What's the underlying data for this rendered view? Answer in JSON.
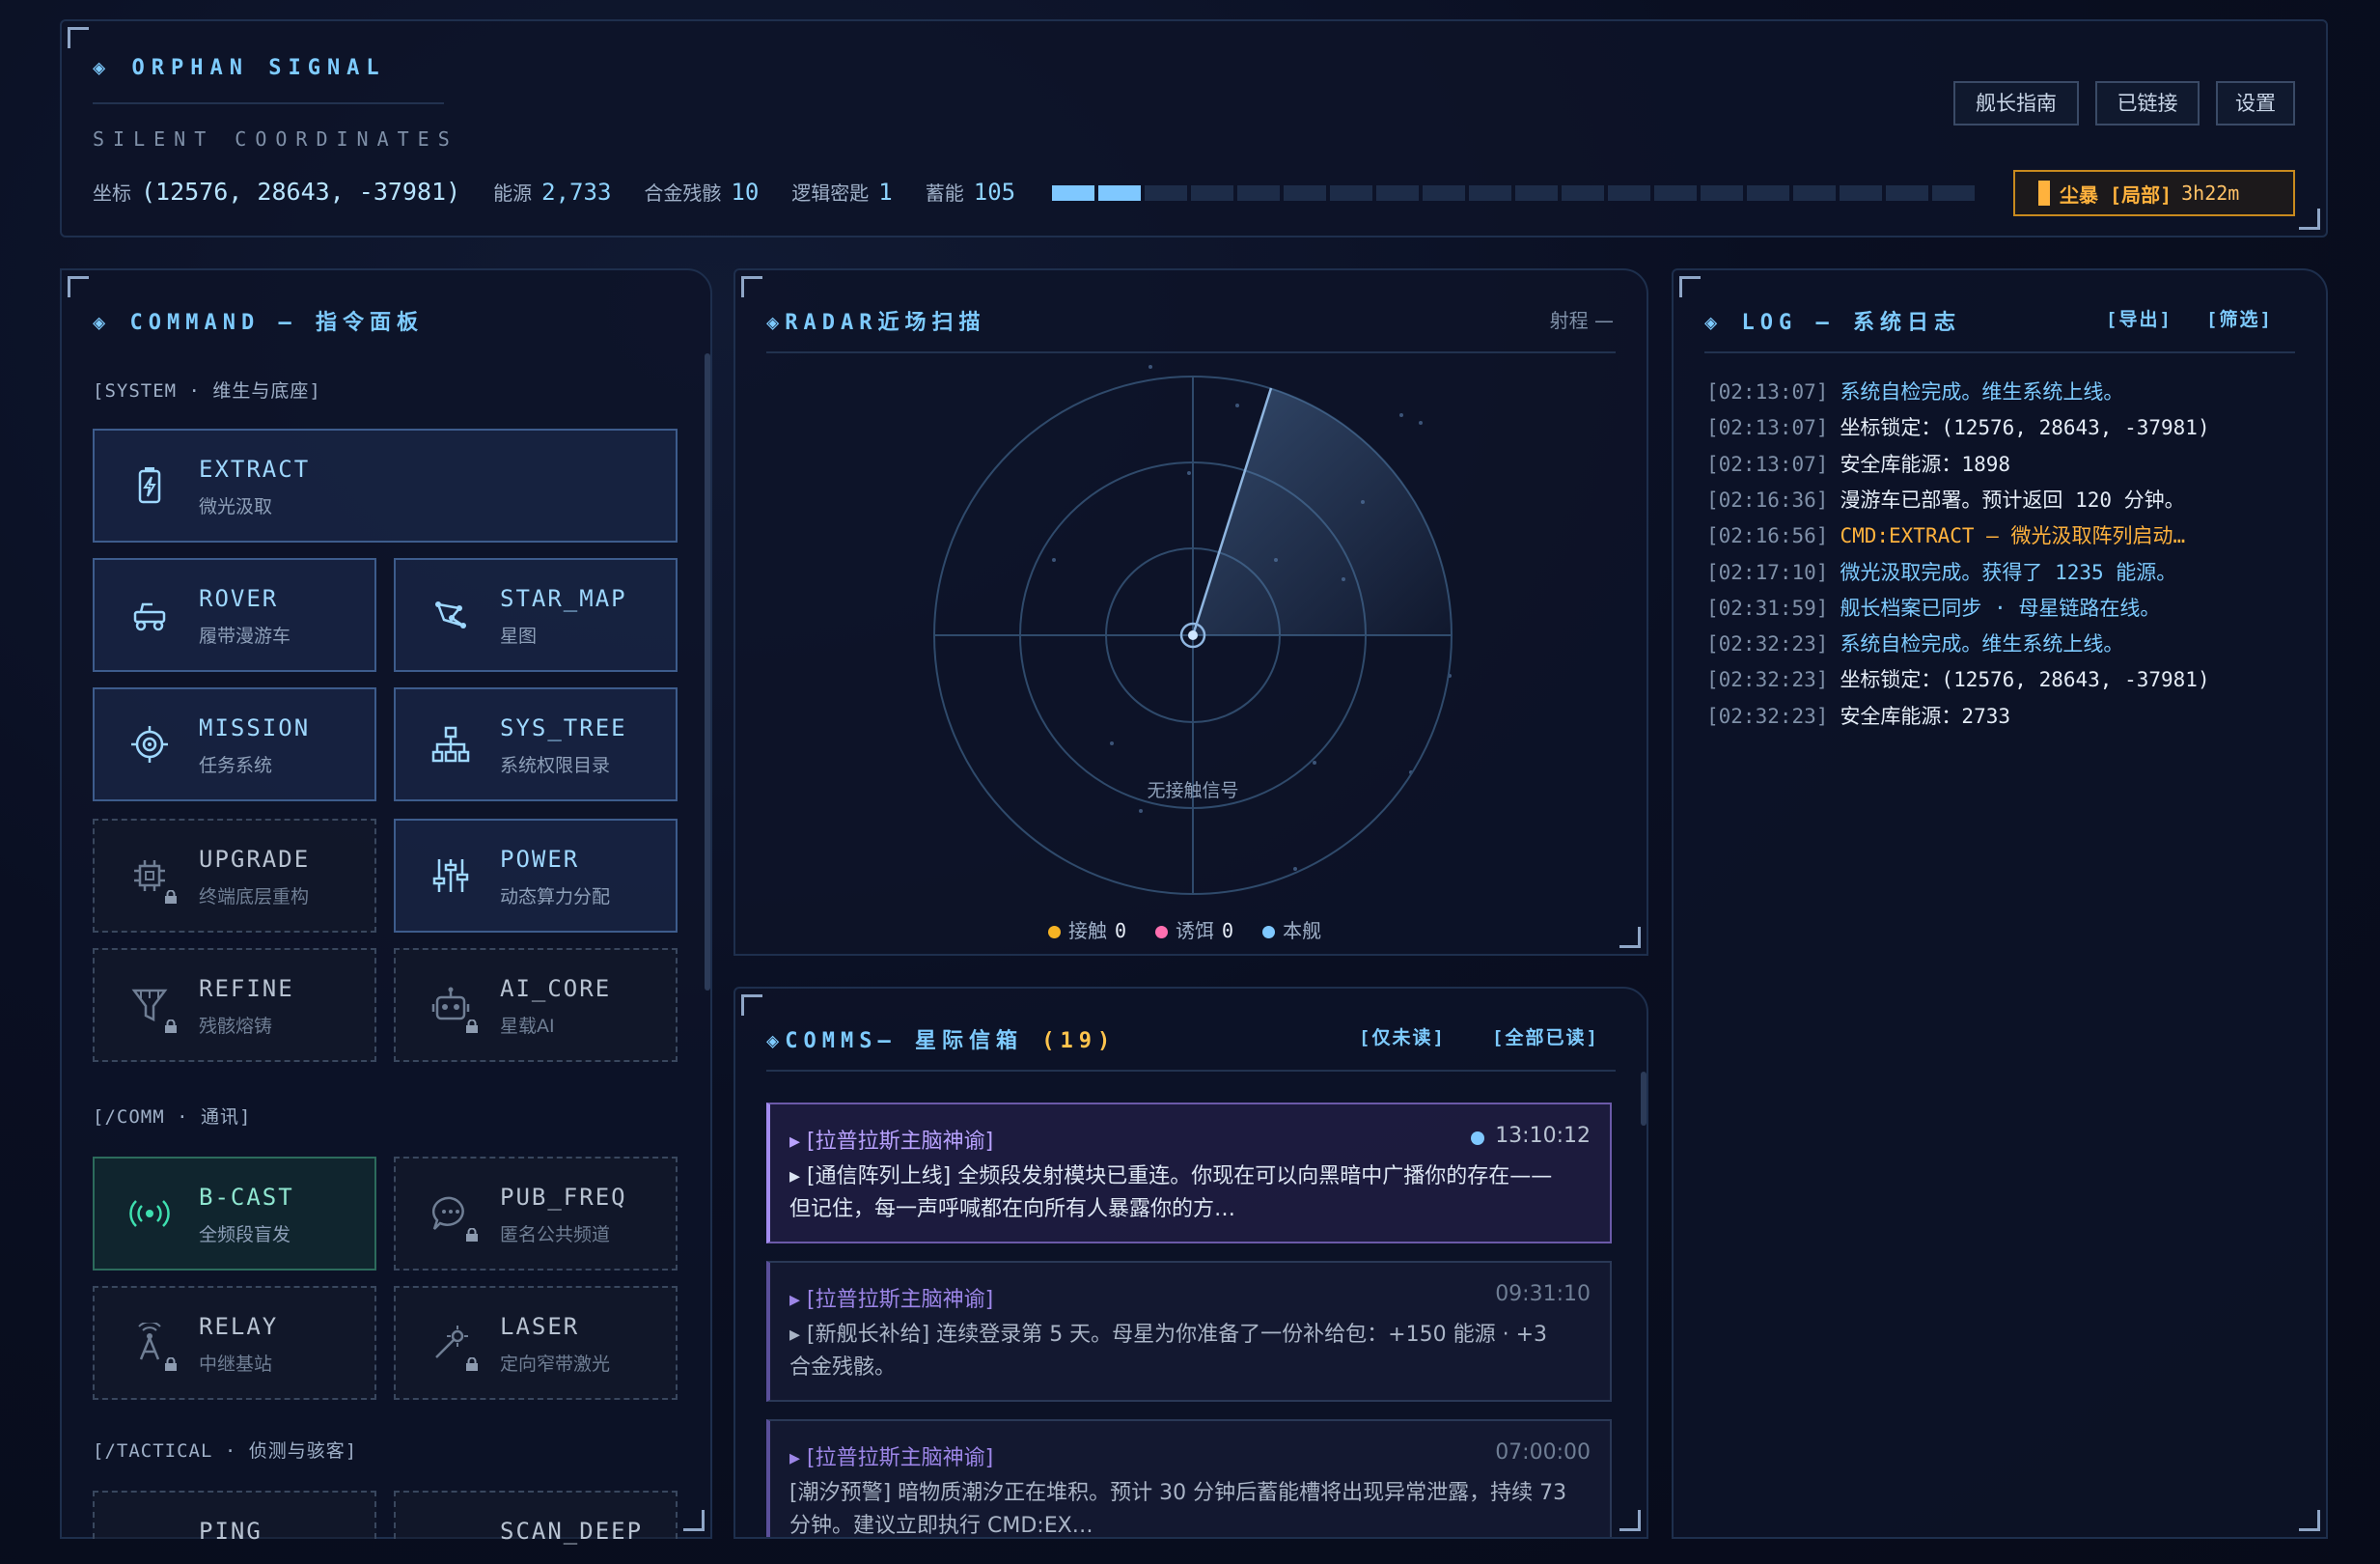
{
  "header": {
    "brand": "◈ ORPHAN SIGNAL",
    "subtitle": "SILENT COORDINATES",
    "stats": {
      "coord_label": "坐标",
      "coord_value": "(12576, 28643, -37981)",
      "energy_label": "能源",
      "energy_value": "2,733",
      "alloy_label": "合金残骸",
      "alloy_value": "10",
      "logic_label": "逻辑密匙",
      "logic_value": "1",
      "storage_label": "蓄能",
      "storage_value": "105",
      "storage_fill_segments": 2,
      "storage_total_segments": 20
    },
    "buttons": {
      "guide": "舰长指南",
      "linked": "已链接",
      "settings": "设置"
    },
    "storm": {
      "tag": "尘暴 [局部]",
      "time": "3h22m",
      "color": "#ffb23d"
    }
  },
  "command": {
    "title": "◈ COMMAND — 指令面板",
    "sections": {
      "system": "[SYSTEM · 维生与底座]",
      "comm": "[/COMM · 通讯]",
      "tactical": "[/TACTICAL · 侦测与骇客]"
    },
    "items": {
      "extract": {
        "name": "EXTRACT",
        "desc": "微光汲取"
      },
      "rover": {
        "name": "ROVER",
        "desc": "履带漫游车"
      },
      "star_map": {
        "name": "STAR_MAP",
        "desc": "星图"
      },
      "mission": {
        "name": "MISSION",
        "desc": "任务系统"
      },
      "sys_tree": {
        "name": "SYS_TREE",
        "desc": "系统权限目录"
      },
      "upgrade": {
        "name": "UPGRADE",
        "desc": "终端底层重构"
      },
      "power": {
        "name": "POWER",
        "desc": "动态算力分配"
      },
      "refine": {
        "name": "REFINE",
        "desc": "残骸熔铸"
      },
      "ai_core": {
        "name": "AI_CORE",
        "desc": "星载AI"
      },
      "b_cast": {
        "name": "B-CAST",
        "desc": "全频段盲发"
      },
      "pub_freq": {
        "name": "PUB_FREQ",
        "desc": "匿名公共频道"
      },
      "relay": {
        "name": "RELAY",
        "desc": "中继基站"
      },
      "laser": {
        "name": "LASER",
        "desc": "定向窄带激光"
      },
      "ping": {
        "name": "PING"
      },
      "scan_deep": {
        "name": "SCAN_DEEP"
      }
    }
  },
  "radar": {
    "title": "◈RADAR近场扫描",
    "range": "射程 —",
    "no_contact": "无接触信号",
    "legend": [
      {
        "label": "接触",
        "count": "0",
        "color": "#f5b324"
      },
      {
        "label": "诱饵",
        "count": "0",
        "color": "#ff6fb0"
      },
      {
        "label": "本舰",
        "count": "",
        "color": "#7fc8ff"
      }
    ]
  },
  "comms": {
    "title": "◈COMMS— 星际信箱",
    "count": "(19)",
    "filter_unread": "[仅未读]",
    "mark_all_read": "[全部已读]",
    "messages": [
      {
        "from": "▸ [拉普拉斯主脑神谕]",
        "time": "13:10:12",
        "body": "▸ [通信阵列上线] 全频段发射模块已重连。你现在可以向黑暗中广播你的存在——但记住，每一声呼喊都在向所有人暴露你的方…"
      },
      {
        "from": "▸ [拉普拉斯主脑神谕]",
        "time": "09:31:10",
        "body": "▸ [新舰长补给] 连续登录第 5 天。母星为你准备了一份补给包：+150 能源 · +3 合金残骸。"
      },
      {
        "from": "▸ [拉普拉斯主脑神谕]",
        "time": "07:00:00",
        "body": "[潮汐预警] 暗物质潮汐正在堆积。预计 30 分钟后蓄能槽将出现异常泄露，持续 73 分钟。建议立即执行 CMD:EX…"
      }
    ]
  },
  "log": {
    "title": "◈ LOG — 系统日志",
    "export": "[导出]",
    "filter": "[筛选]",
    "entries": [
      {
        "ts": "[02:13:07]",
        "text": "系统自检完成。维生系统上线。",
        "level": "info"
      },
      {
        "ts": "[02:13:07]",
        "text": "坐标锁定：(12576, 28643, -37981)",
        "level": "plain"
      },
      {
        "ts": "[02:13:07]",
        "text": "安全库能源：1898",
        "level": "plain"
      },
      {
        "ts": "[02:16:36]",
        "text": "漫游车已部署。预计返回 120 分钟。",
        "level": "plain"
      },
      {
        "ts": "[02:16:56]",
        "text": "CMD:EXTRACT — 微光汲取阵列启动…",
        "level": "warn"
      },
      {
        "ts": "[02:17:10]",
        "text": "微光汲取完成。获得了 1235 能源。",
        "level": "info"
      },
      {
        "ts": "[02:31:59]",
        "text": "舰长档案已同步 · 母星链路在线。",
        "level": "info"
      },
      {
        "ts": "[02:32:23]",
        "text": "系统自检完成。维生系统上线。",
        "level": "info"
      },
      {
        "ts": "[02:32:23]",
        "text": "坐标锁定：(12576, 28643, -37981)",
        "level": "plain"
      },
      {
        "ts": "[02:32:23]",
        "text": "安全库能源：2733",
        "level": "plain"
      }
    ]
  }
}
